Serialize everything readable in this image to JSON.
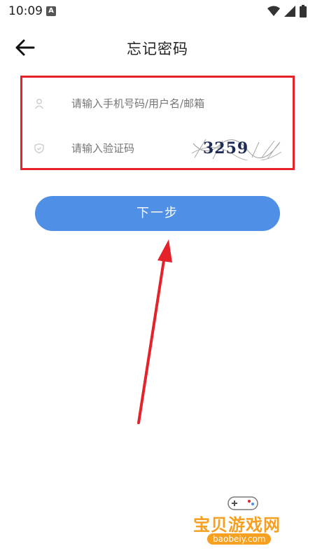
{
  "status": {
    "time": "10:09",
    "a_icon": "A"
  },
  "header": {
    "title": "忘记密码"
  },
  "form": {
    "account_placeholder": "请输入手机号码/用户名/邮箱",
    "code_placeholder": "请输入验证码",
    "captcha_text": "3259"
  },
  "buttons": {
    "next": "下一步"
  },
  "watermark": {
    "cn": "宝贝游戏网",
    "en": "baobeiy.com"
  },
  "colors": {
    "primary": "#4f8fe6",
    "highlight": "#e5212a",
    "watermark": "#f6a021"
  }
}
